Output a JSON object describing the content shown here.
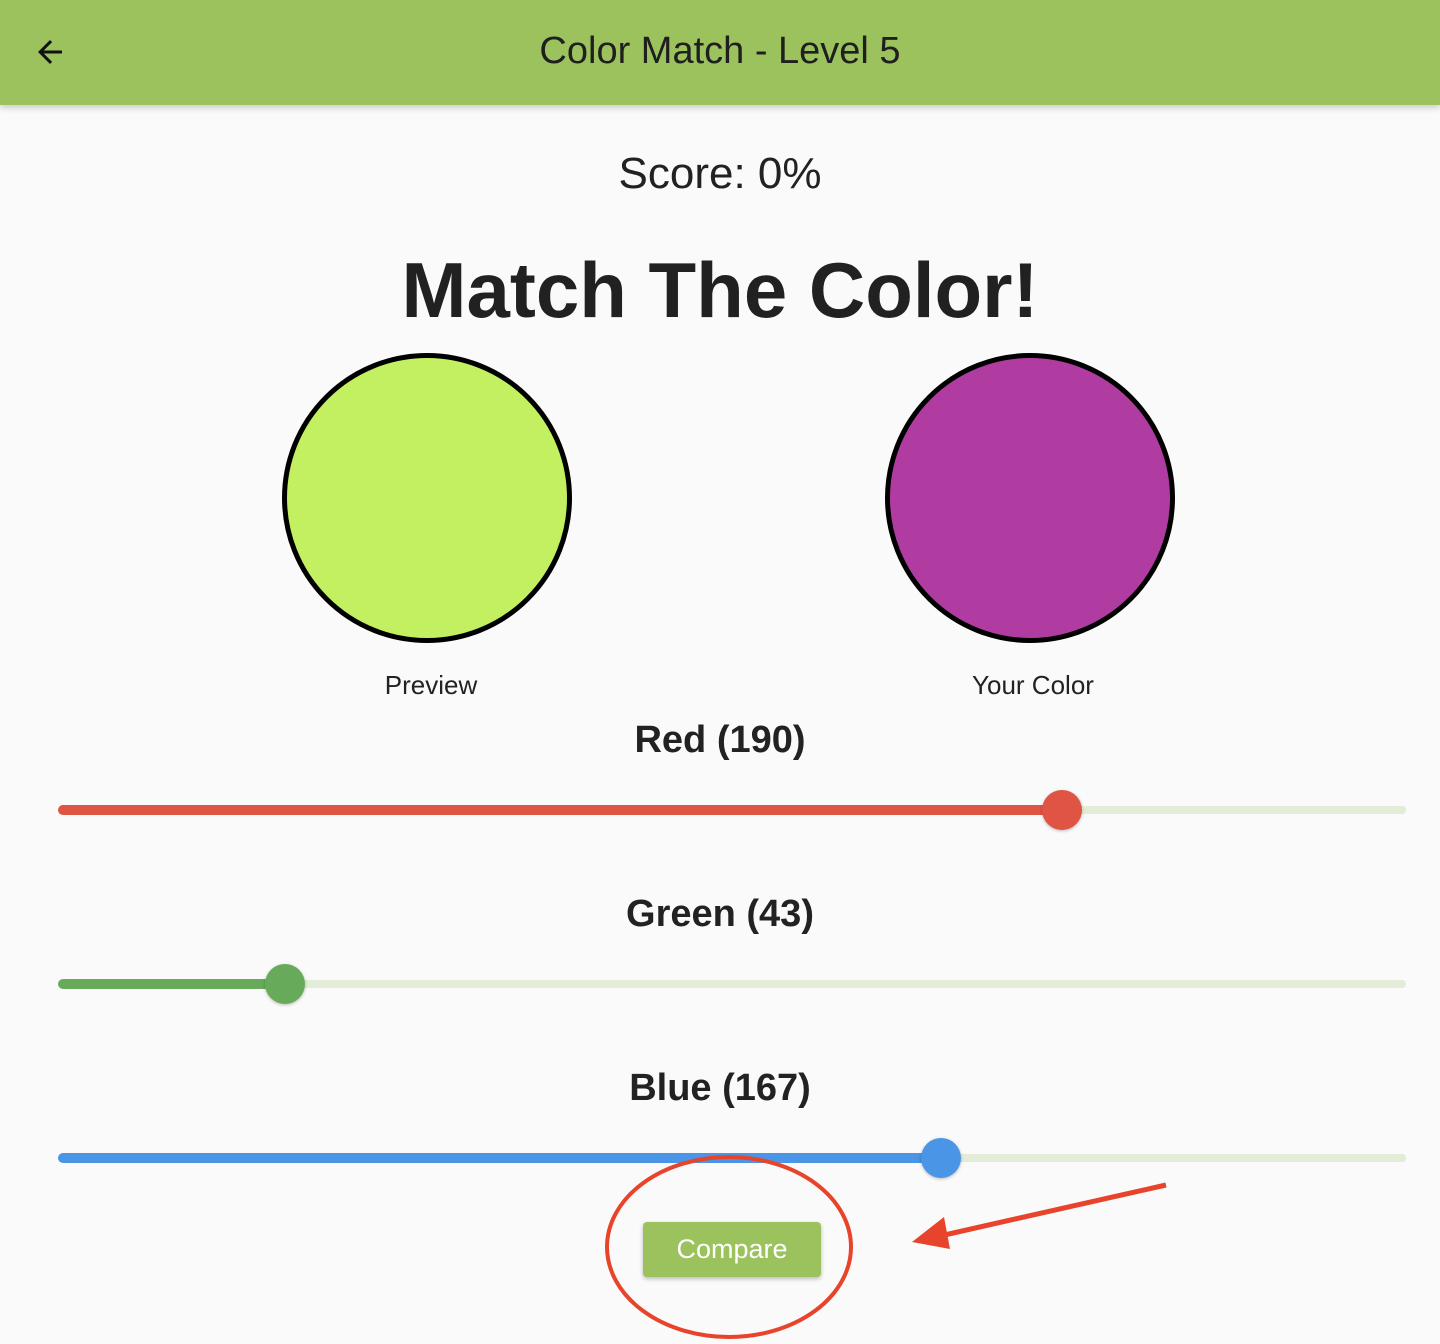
{
  "app_bar": {
    "title": "Color Match - Level 5",
    "back_icon": "arrow-left-icon",
    "background_color": "#9bc25d"
  },
  "score": {
    "text": "Score: 0%"
  },
  "heading": "Match The Color!",
  "swatches": {
    "preview": {
      "label": "Preview",
      "color": "#c2f061"
    },
    "your_color": {
      "label": "Your Color",
      "color": "#b03ca2"
    }
  },
  "sliders": [
    {
      "label": "Red (190)",
      "value": 190,
      "max": 255,
      "color": "#e05444"
    },
    {
      "label": "Green (43)",
      "value": 43,
      "max": 255,
      "color": "#67ab5a"
    },
    {
      "label": "Blue (167)",
      "value": 167,
      "max": 255,
      "color": "#4a95e6"
    }
  ],
  "compare_button": {
    "label": "Compare"
  },
  "annotation": {
    "color": "#e8432b"
  }
}
